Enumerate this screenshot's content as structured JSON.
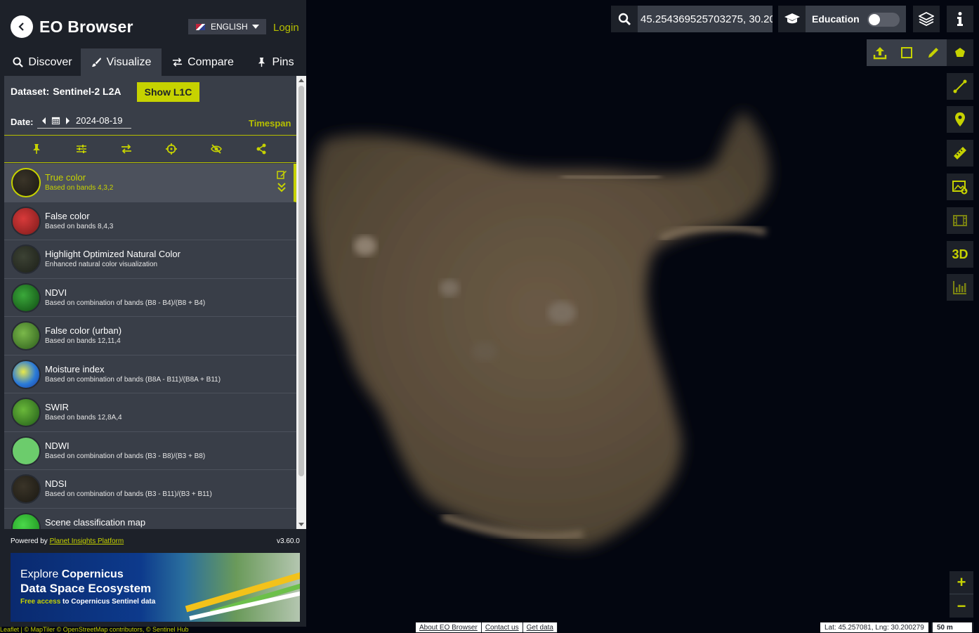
{
  "app": {
    "title": "EO Browser",
    "language": "ENGLISH",
    "login": "Login"
  },
  "tabs": [
    {
      "label": "Discover"
    },
    {
      "label": "Visualize"
    },
    {
      "label": "Compare"
    },
    {
      "label": "Pins"
    }
  ],
  "dataset": {
    "label": "Dataset:",
    "name": "Sentinel-2 L2A",
    "toggle_label": "Show L1C"
  },
  "date": {
    "label": "Date:",
    "value": "2024-08-19",
    "timespan": "Timespan"
  },
  "layers": [
    {
      "name": "True color",
      "description": "Based on bands 4,3,2",
      "active": true,
      "color": "#2a2720"
    },
    {
      "name": "False color",
      "description": "Based on bands 8,4,3",
      "color": "#b52a2a"
    },
    {
      "name": "Highlight Optimized Natural Color",
      "description": "Enhanced natural color visualization",
      "color": "#2b2f26"
    },
    {
      "name": "NDVI",
      "description": "Based on combination of bands (B8 - B4)/(B8 + B4)",
      "color": "#1f7a1f"
    },
    {
      "name": "False color (urban)",
      "description": "Based on bands 12,11,4",
      "color": "#4a8a2a"
    },
    {
      "name": "Moisture index",
      "description": "Based on combination of bands (B8A - B11)/(B8A + B11)",
      "color": "#3a9ad8"
    },
    {
      "name": "SWIR",
      "description": "Based on bands 12,8A,4",
      "color": "#3c8c2c"
    },
    {
      "name": "NDWI",
      "description": "Based on combination of bands (B3 - B8)/(B3 + B8)",
      "color": "#6ccc6c"
    },
    {
      "name": "NDSI",
      "description": "Based on combination of bands (B3 - B11)/(B3 + B11)",
      "color": "#2a2720"
    },
    {
      "name": "Scene classification map",
      "description": "",
      "color": "#2fb82f"
    }
  ],
  "footer": {
    "powered_by": "Powered by ",
    "platform_link": "Planet Insights Platform",
    "version": "v3.60.0",
    "banner_line1": "Explore ",
    "banner_line1_bold": "Copernicus",
    "banner_line2": "Data Space Ecosystem",
    "banner_line3_accent": "Free access",
    "banner_line3": " to Copernicus Sentinel data"
  },
  "search": {
    "value": "45.254369525703275, 30.20"
  },
  "education": {
    "label": "Education"
  },
  "map": {
    "attribution": "Leaflet | © MapTiler © OpenStreetMap contributors, © Sentinel Hub",
    "links": [
      "About EO Browser",
      "Contact us",
      "Get data"
    ],
    "latlng": "Lat: 45.257081, Lng: 30.200279",
    "scale": "50 m",
    "tool_3d": "3D",
    "zoom_in": "+",
    "zoom_out": "−"
  },
  "colors": {
    "accent": "#c6d200",
    "panel": "#1d2129",
    "panel_light": "#393e48"
  }
}
